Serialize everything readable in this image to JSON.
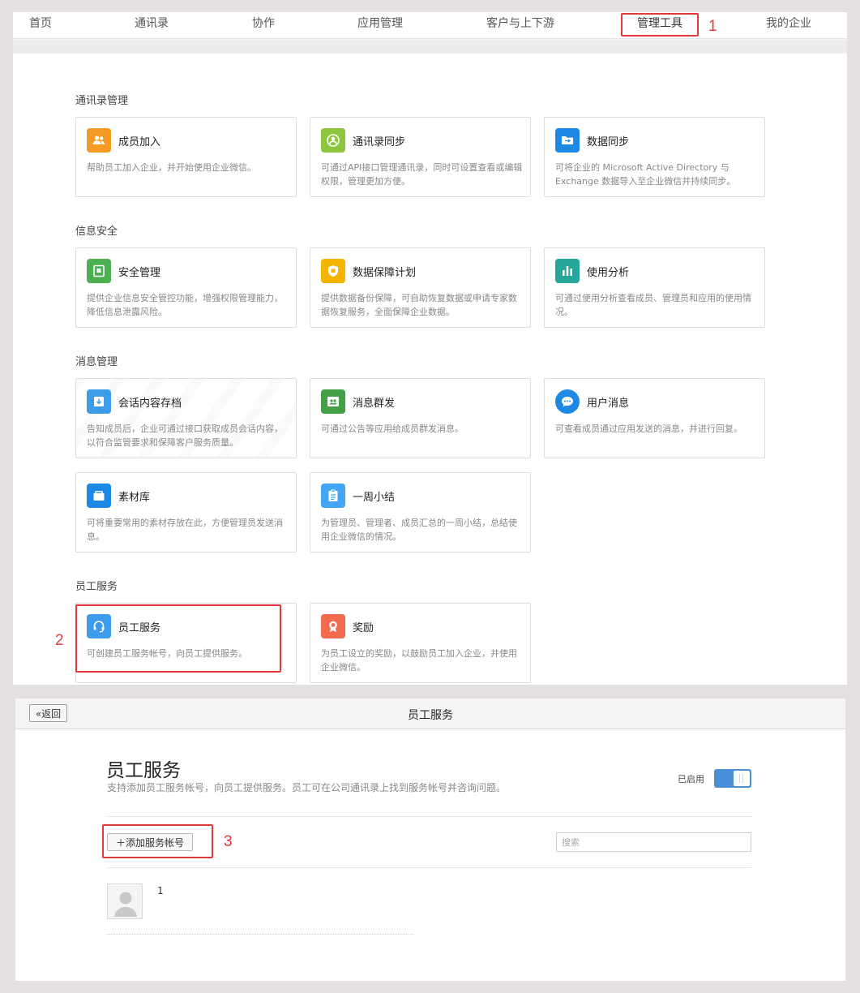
{
  "nav": {
    "items": [
      "首页",
      "通讯录",
      "协作",
      "应用管理",
      "客户与上下游",
      "管理工具",
      "我的企业"
    ],
    "active": "管理工具"
  },
  "annotations": [
    "1",
    "2",
    "3"
  ],
  "accent_color": "#e4393c",
  "sections": [
    {
      "title": "通讯录管理",
      "cards": [
        {
          "title": "成员加入",
          "desc": "帮助员工加入企业，并开始使用企业微信。",
          "icon": "add-members-icon",
          "color": "#f59a23"
        },
        {
          "title": "通讯录同步",
          "desc": "可通过API接口管理通讯录，同时可设置查看或编辑权限，管理更加方便。",
          "icon": "sync-icon",
          "color": "#8cc63f"
        },
        {
          "title": "数据同步",
          "desc": "可将企业的 Microsoft Active Directory 与 Exchange 数据导入至企业微信并持续同步。",
          "icon": "folder-sync-icon",
          "color": "#1e88e5"
        }
      ]
    },
    {
      "title": "信息安全",
      "cards": [
        {
          "title": "安全管理",
          "desc": "提供企业信息安全管控功能，增强权限管理能力，降低信息泄露风险。",
          "icon": "safe-icon",
          "color": "#4caf50"
        },
        {
          "title": "数据保障计划",
          "desc": "提供数据备份保障，可自助恢复数据或申请专家数据恢复服务，全面保障企业数据。",
          "icon": "shield-icon",
          "color": "#f5b400"
        },
        {
          "title": "使用分析",
          "desc": "可通过使用分析查看成员、管理员和应用的使用情况。",
          "icon": "bar-chart-icon",
          "color": "#26a69a"
        }
      ]
    },
    {
      "title": "消息管理",
      "cards": [
        {
          "title": "会话内容存档",
          "desc": "告知成员后，企业可通过接口获取成员会话内容，以符合监管要求和保障客户服务质量。",
          "icon": "archive-icon",
          "color": "#3d9be9"
        },
        {
          "title": "消息群发",
          "desc": "可通过公告等应用给成员群发消息。",
          "icon": "broadcast-icon",
          "color": "#43a047"
        },
        {
          "title": "用户消息",
          "desc": "可查看成员通过应用发送的消息，并进行回复。",
          "icon": "chat-bubble-icon",
          "color": "#1e88e5"
        },
        {
          "title": "素材库",
          "desc": "可将重要常用的素材存放在此，方便管理员发送消息。",
          "icon": "media-library-icon",
          "color": "#1e88e5"
        },
        {
          "title": "一周小结",
          "desc": "为管理员、管理者、成员汇总的一周小结，总结使用企业微信的情况。",
          "icon": "clipboard-icon",
          "color": "#42a5f5"
        }
      ]
    },
    {
      "title": "员工服务",
      "cards": [
        {
          "title": "员工服务",
          "desc": "可创建员工服务帐号，向员工提供服务。",
          "icon": "headset-icon",
          "color": "#3d9be9"
        },
        {
          "title": "奖励",
          "desc": "为员工设立的奖励，以鼓励员工加入企业，并使用企业微信。",
          "icon": "award-icon",
          "color": "#f26b4f"
        }
      ]
    }
  ],
  "detail": {
    "back_label": "«返回",
    "header_title": "员工服务",
    "heading": "员工服务",
    "description": "支持添加员工服务帐号，向员工提供服务。员工可在公司通讯录上找到服务帐号并咨询问题。",
    "enabled_label": "已启用",
    "toggle_on": true,
    "toggle_color": "#4a90d9",
    "add_button": "＋添加服务帐号",
    "search_placeholder": "搜索",
    "search_value": "",
    "accounts": [
      {
        "name": "1",
        "avatar": "default-avatar-icon"
      }
    ]
  }
}
